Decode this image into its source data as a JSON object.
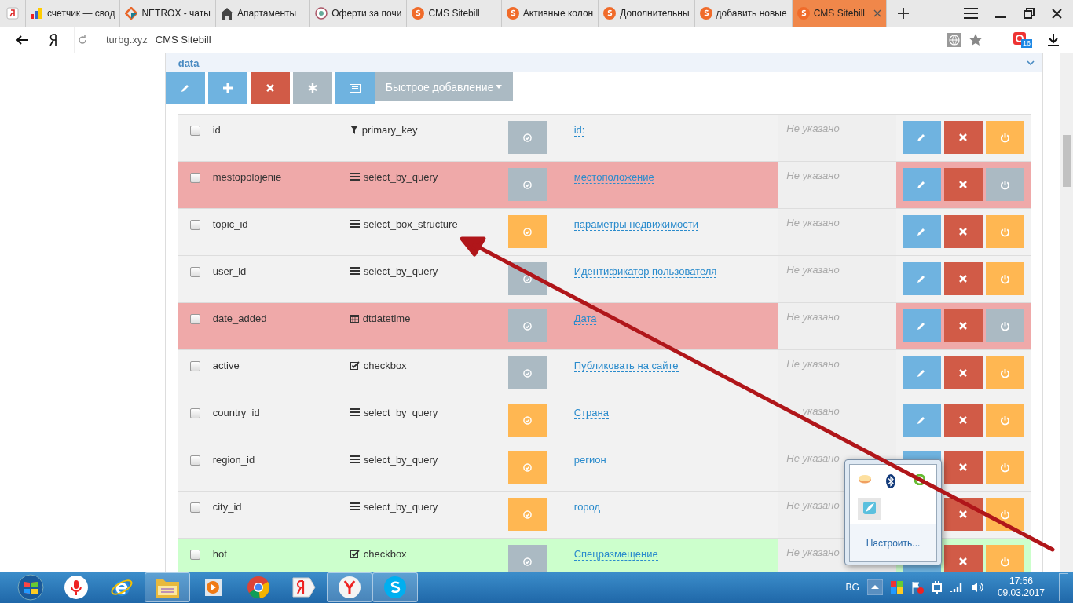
{
  "browser": {
    "tabs": [
      {
        "kind": "pinned",
        "selected": false
      },
      {
        "kind": "chart",
        "title": "счетчик — свод",
        "selected": false
      },
      {
        "kind": "diamond",
        "title": "NETROX - чаты",
        "selected": false
      },
      {
        "kind": "house",
        "title": "Апартаменты",
        "selected": false
      },
      {
        "kind": "bg",
        "title": "Оферти за почи",
        "selected": false
      },
      {
        "kind": "s",
        "title": "CMS Sitebill",
        "selected": false
      },
      {
        "kind": "s",
        "title": "Активные колон",
        "selected": false
      },
      {
        "kind": "s",
        "title": "Дополнительны",
        "selected": false
      },
      {
        "kind": "s",
        "title": "добавить новые",
        "selected": false
      },
      {
        "kind": "s",
        "title": "CMS Sitebill",
        "selected": true
      }
    ],
    "address": {
      "host": "turbg.xyz",
      "title": "CMS Sitebill"
    },
    "extension_badge": "16"
  },
  "panel": {
    "title": "data",
    "quick_add": "Быстрое добавление"
  },
  "rows": [
    {
      "checked": false,
      "name": "id",
      "type": "primary_key",
      "kind": "filter",
      "status": {
        "color": "#abbac3"
      },
      "caption": "id:",
      "placeholder": "Не указано",
      "power": {
        "color": "#ffb752"
      },
      "color": "#f2f2f2"
    },
    {
      "checked": false,
      "name": "mestopolojenie",
      "type": "select_by_query",
      "kind": "list",
      "status": {
        "color": "#abbac3"
      },
      "caption": "местоположение",
      "placeholder": "Не указано",
      "power": {
        "color": "#abbac3"
      },
      "color": "#efa9a9"
    },
    {
      "checked": false,
      "name": "topic_id",
      "type": "select_box_structure",
      "kind": "list",
      "status": {
        "color": "#ffb752"
      },
      "caption": "параметры недвижимости",
      "placeholder": "Не указано",
      "power": {
        "color": "#ffb752"
      },
      "color": "#f2f2f2"
    },
    {
      "checked": false,
      "name": "user_id",
      "type": "select_by_query",
      "kind": "list",
      "status": {
        "color": "#abbac3"
      },
      "caption": "Идентификатор пользователя",
      "placeholder": "Не указано",
      "power": {
        "color": "#ffb752"
      },
      "color": "#f2f2f2"
    },
    {
      "checked": false,
      "name": "date_added",
      "type": "dtdatetime",
      "kind": "calendar",
      "status": {
        "color": "#abbac3"
      },
      "caption": "Дата",
      "placeholder": "Не указано",
      "power": {
        "color": "#abbac3"
      },
      "color": "#efa9a9"
    },
    {
      "checked": false,
      "name": "active",
      "type": "checkbox",
      "kind": "check",
      "status": {
        "color": "#abbac3"
      },
      "caption": "Публиковать на сайте",
      "placeholder": "Не указано",
      "power": {
        "color": "#ffb752"
      },
      "color": "#f2f2f2"
    },
    {
      "checked": false,
      "name": "country_id",
      "type": "select_by_query",
      "kind": "list",
      "status": {
        "color": "#ffb752"
      },
      "caption": "Страна",
      "placeholder": "указано",
      "power": {
        "color": "#ffb752"
      },
      "color": "#f2f2f2"
    },
    {
      "checked": false,
      "name": "region_id",
      "type": "select_by_query",
      "kind": "list",
      "status": {
        "color": "#ffb752"
      },
      "caption": "регион",
      "placeholder": "Не указано",
      "power": {
        "color": "#ffb752"
      },
      "edit": {
        "kind": "blank"
      },
      "color": "#f2f2f2"
    },
    {
      "checked": false,
      "name": "city_id",
      "type": "select_by_query",
      "kind": "list",
      "status": {
        "color": "#ffb752"
      },
      "caption": "город",
      "placeholder": "Не указано",
      "power": {
        "color": "#ffb752"
      },
      "edit": {
        "kind": "hidden"
      },
      "color": "#f2f2f2"
    },
    {
      "checked": false,
      "name": "hot",
      "type": "checkbox",
      "kind": "check",
      "status": {
        "color": "#abbac3"
      },
      "caption": "Спецразмещение",
      "placeholder": "Не указано",
      "power": {
        "color": "#ffb752"
      },
      "edit": {
        "kind": "blank"
      },
      "color": "#ccffcc"
    }
  ],
  "tray_popup": {
    "link": "Настроить..."
  },
  "taskbar": {
    "language": "BG",
    "time": "17:56",
    "date": "09.03.2017"
  }
}
